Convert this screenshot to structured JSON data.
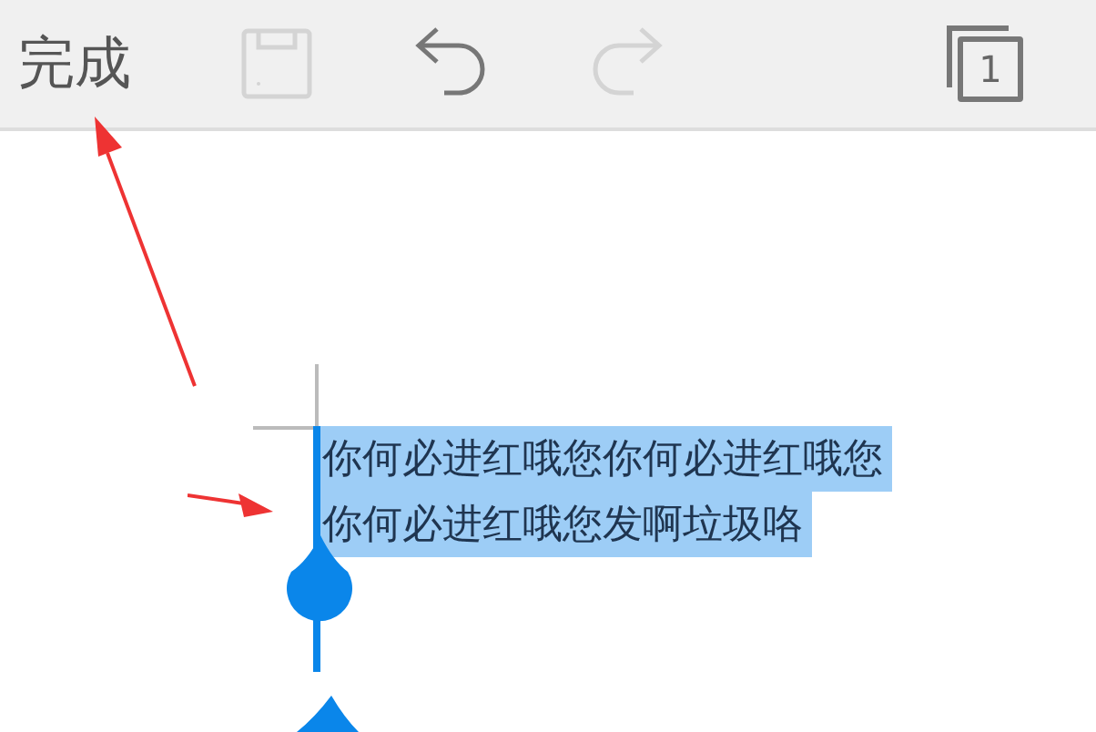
{
  "toolbar": {
    "done": "完成",
    "tools": [
      {
        "kind": "save",
        "disabled": true
      },
      {
        "kind": "undo",
        "disabled": false
      },
      {
        "kind": "redo",
        "disabled": true
      }
    ],
    "page_count": "1"
  },
  "editor": {
    "selected": true,
    "lines": [
      "你何必进红哦您你何必进红哦您",
      "你何必进红哦您发啊垃圾咯"
    ]
  }
}
